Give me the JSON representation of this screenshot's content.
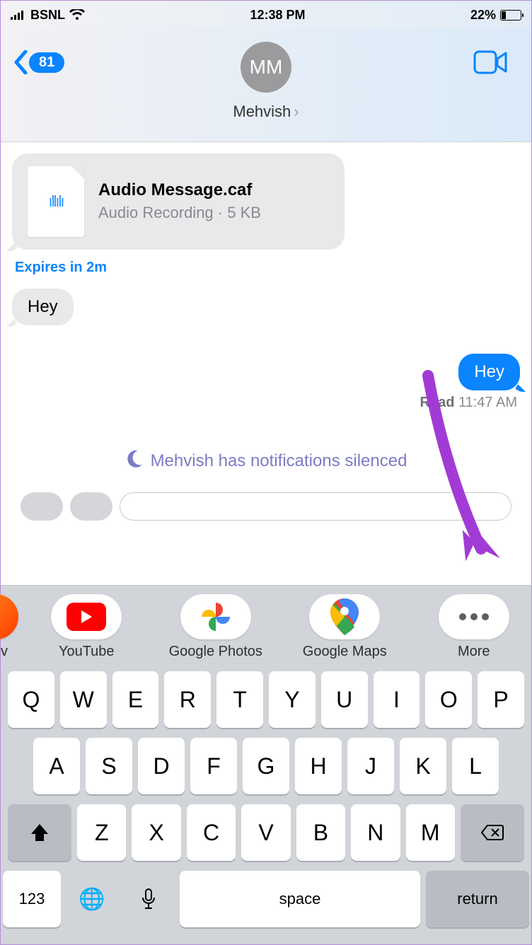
{
  "status_bar": {
    "carrier": "BSNL",
    "time": "12:38 PM",
    "battery_percent": "22%"
  },
  "header": {
    "back_badge": "81",
    "avatar_initials": "MM",
    "contact_name": "Mehvish"
  },
  "messages": {
    "audio_attachment": {
      "title": "Audio Message.caf",
      "subtitle_type": "Audio Recording",
      "subtitle_size": "5 KB",
      "expires_label": "Expires in 2m"
    },
    "incoming_text": "Hey",
    "outgoing_text": "Hey",
    "read_label": "Read",
    "read_time": "11:47 AM",
    "silenced_text": "Mehvish has notifications silenced"
  },
  "app_row": {
    "partial_label": "v",
    "items": [
      {
        "label": "YouTube"
      },
      {
        "label": "Google Photos"
      },
      {
        "label": "Google Maps"
      },
      {
        "label": "More"
      }
    ]
  },
  "keyboard": {
    "row1": [
      "Q",
      "W",
      "E",
      "R",
      "T",
      "Y",
      "U",
      "I",
      "O",
      "P"
    ],
    "row2": [
      "A",
      "S",
      "D",
      "F",
      "G",
      "H",
      "J",
      "K",
      "L"
    ],
    "row3": [
      "Z",
      "X",
      "C",
      "V",
      "B",
      "N",
      "M"
    ],
    "num_key": "123",
    "space_key": "space",
    "return_key": "return"
  }
}
